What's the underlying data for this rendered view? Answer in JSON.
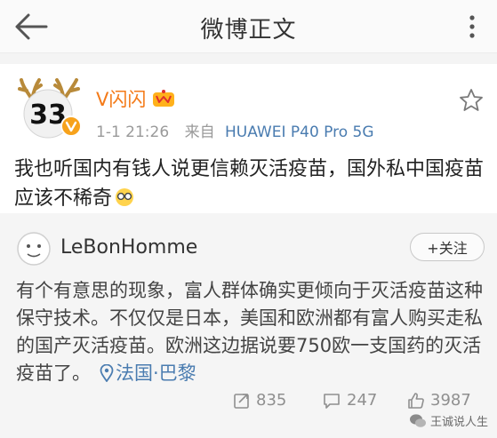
{
  "header": {
    "title": "微博正文",
    "back_icon": "back-arrow-icon",
    "more_icon": "more-vertical-icon"
  },
  "post": {
    "author": "V闪闪",
    "avatar_text": "33",
    "time": "1-1 21:26",
    "source_label": "来自",
    "device": "HUAWEI P40 Pro 5G",
    "text": "我也听国内有钱人说更信赖灭活疫苗，国外私中国疫苗应该不稀奇",
    "name_color": "#f47a18"
  },
  "repost": {
    "author": "LeBonHomme",
    "follow_label": "+关注",
    "text": "有个有意思的现象，富人群体确实更倾向于灭活疫苗这种保守技术。不仅仅是日本，美国和欧洲都有富人购买走私的国产灭活疫苗。欧洲这边据说要750欧一支国药的灭活疫苗了。",
    "location": "法国·巴黎"
  },
  "actions": {
    "repost_count": "835",
    "comment_count": "247",
    "like_count": "3987"
  },
  "watermark": {
    "text": "王诚说人生"
  },
  "colors": {
    "link": "#4a7cb0",
    "muted": "#9a9a9a",
    "repost_bg": "#f5f5f5"
  }
}
